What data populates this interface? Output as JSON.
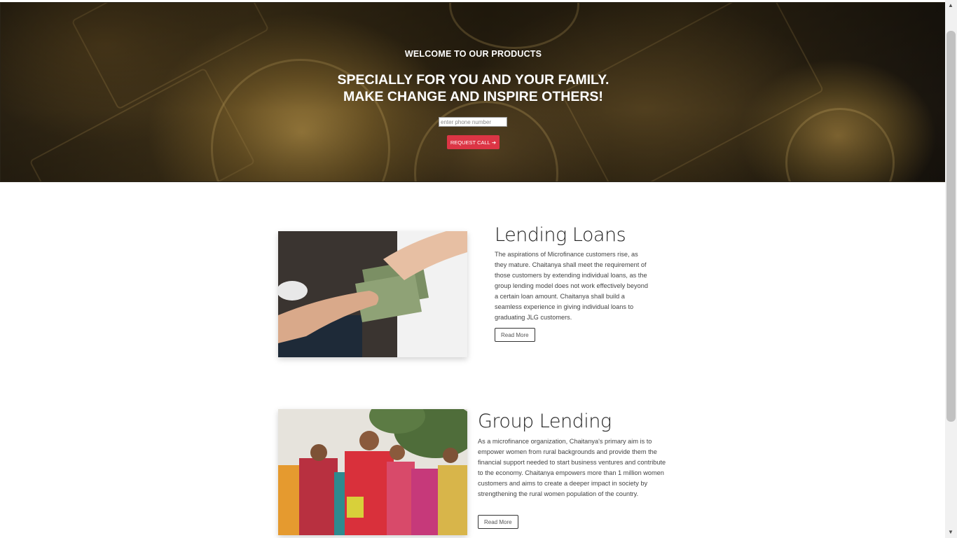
{
  "hero": {
    "kicker": "WELCOME TO OUR PRODUCTS",
    "title_line1": "SPECIALLY FOR YOU AND YOUR FAMILY.",
    "title_line2": "MAKE CHANGE AND INSPIRE OTHERS!",
    "phone_placeholder": "enter phone number",
    "request_label": "REQUEST CALL",
    "request_arrow": "➔"
  },
  "products": [
    {
      "heading": "Lending Loans",
      "text": "The aspirations of Microfinance customers rise, as they mature. Chaitanya shall meet the requirement of those customers by extending individual loans, as the group lending model does not work effectively beyond a certain loan amount. Chaitanya shall build a seamless experience in giving individual loans to graduating JLG customers.",
      "button": "Read More"
    },
    {
      "heading": "Group Lending",
      "text": "As a microfinance organization, Chaitanya's primary aim is to empower women from rural backgrounds and provide them the financial support needed to start business ventures and contribute to the economy. Chaitanya empowers more than 1 million women customers and aims to create a deeper impact in society by strengthening the rural women population of the country.",
      "button": "Read More"
    }
  ],
  "scrollbar": {
    "up_icon": "▲",
    "down_icon": "▼"
  },
  "colors": {
    "accent": "#dc3545"
  }
}
